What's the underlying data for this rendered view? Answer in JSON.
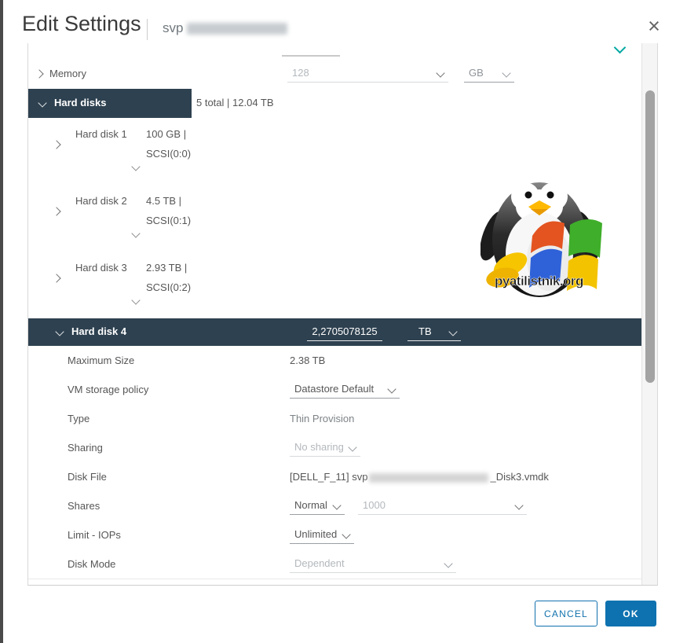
{
  "colors": {
    "accent_blue": "#0e72b0",
    "header_dark": "#2e4150",
    "teal_chevron": "#00a8a2"
  },
  "header": {
    "title": "Edit Settings",
    "vm_name_prefix": "svp",
    "close_icon": "×"
  },
  "memory_row": {
    "label": "Memory",
    "value": "128",
    "unit": "GB"
  },
  "hard_disks_row": {
    "label": "Hard disks",
    "summary": "5 total | 12.04 TB"
  },
  "disks": [
    {
      "label": "Hard disk 1",
      "size": "100 GB |",
      "bus": "SCSI(0:0)"
    },
    {
      "label": "Hard disk 2",
      "size": "4.5 TB |",
      "bus": "SCSI(0:1)"
    },
    {
      "label": "Hard disk 3",
      "size": "2.93 TB |",
      "bus": "SCSI(0:2)"
    }
  ],
  "disk4": {
    "label": "Hard disk 4",
    "size_value": "2,2705078125",
    "size_unit": "TB",
    "maximum_size": {
      "label": "Maximum Size",
      "value": "2.38 TB"
    },
    "vm_storage_policy": {
      "label": "VM storage policy",
      "value": "Datastore Default"
    },
    "type": {
      "label": "Type",
      "value": "Thin Provision"
    },
    "sharing": {
      "label": "Sharing",
      "value": "No sharing"
    },
    "disk_file": {
      "label": "Disk File",
      "value_prefix": "[DELL_F_11] svp",
      "value_suffix": "_Disk3.vmdk"
    },
    "shares": {
      "label": "Shares",
      "level": "Normal",
      "value": "1000"
    },
    "limit_iops": {
      "label": "Limit - IOPs",
      "value": "Unlimited"
    },
    "disk_mode": {
      "label": "Disk Mode",
      "value": "Dependent"
    }
  },
  "watermark": {
    "text": "pyatilistnik.org"
  },
  "footer": {
    "cancel_label": "CANCEL",
    "ok_label": "OK"
  }
}
